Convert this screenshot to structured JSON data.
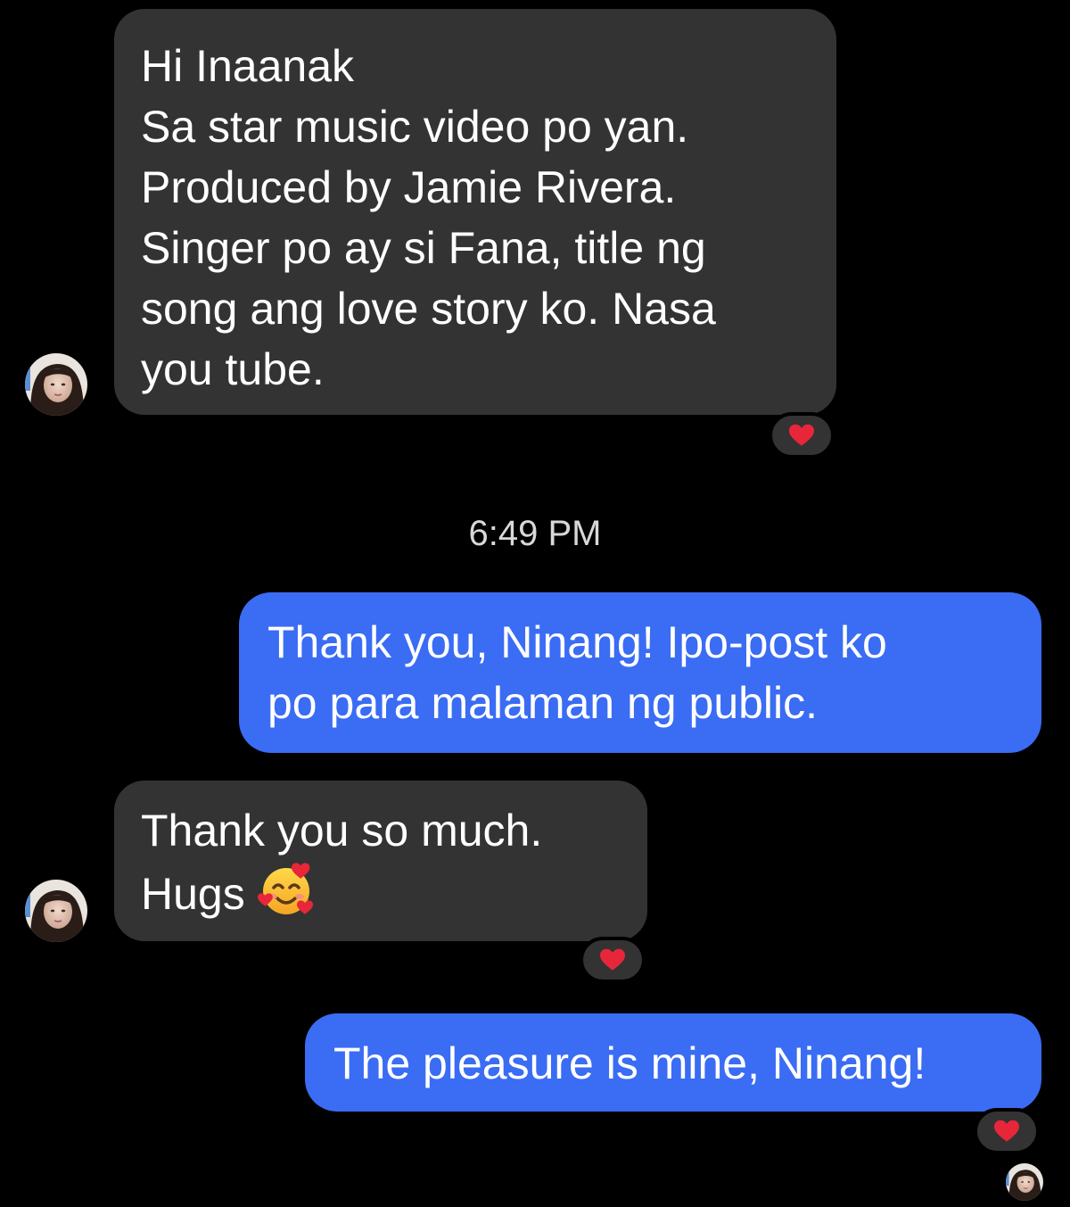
{
  "conversation": {
    "messages": [
      {
        "sender": "Ninang",
        "lines": [
          "Hi Inaanak",
          "Sa star music video po yan.",
          "Produced by Jamie Rivera.",
          "Singer po ay si Fana, title ng",
          "song ang love story ko. Nasa",
          "you tube."
        ],
        "reaction": "heart"
      },
      {
        "sender": "me",
        "lines": [
          "Thank you, Ninang! Ipo-post ko",
          "po para malaman ng public."
        ]
      },
      {
        "sender": "Ninang",
        "lines": [
          "Thank you so much.",
          "Hugs"
        ],
        "emoji": "smiling-face-with-hearts",
        "reaction": "heart"
      },
      {
        "sender": "me",
        "lines": [
          "The pleasure is mine, Ninang!"
        ],
        "reaction": "heart",
        "seen_by": "Ninang"
      }
    ],
    "timestamp": "6:49 PM"
  },
  "colors": {
    "background": "#000000",
    "incoming_bubble": "#333333",
    "outgoing_bubble": "#3a6cf4",
    "reaction_heart": "#e8263a"
  },
  "icons": {
    "reaction": "heart-icon",
    "avatar": "avatar"
  }
}
